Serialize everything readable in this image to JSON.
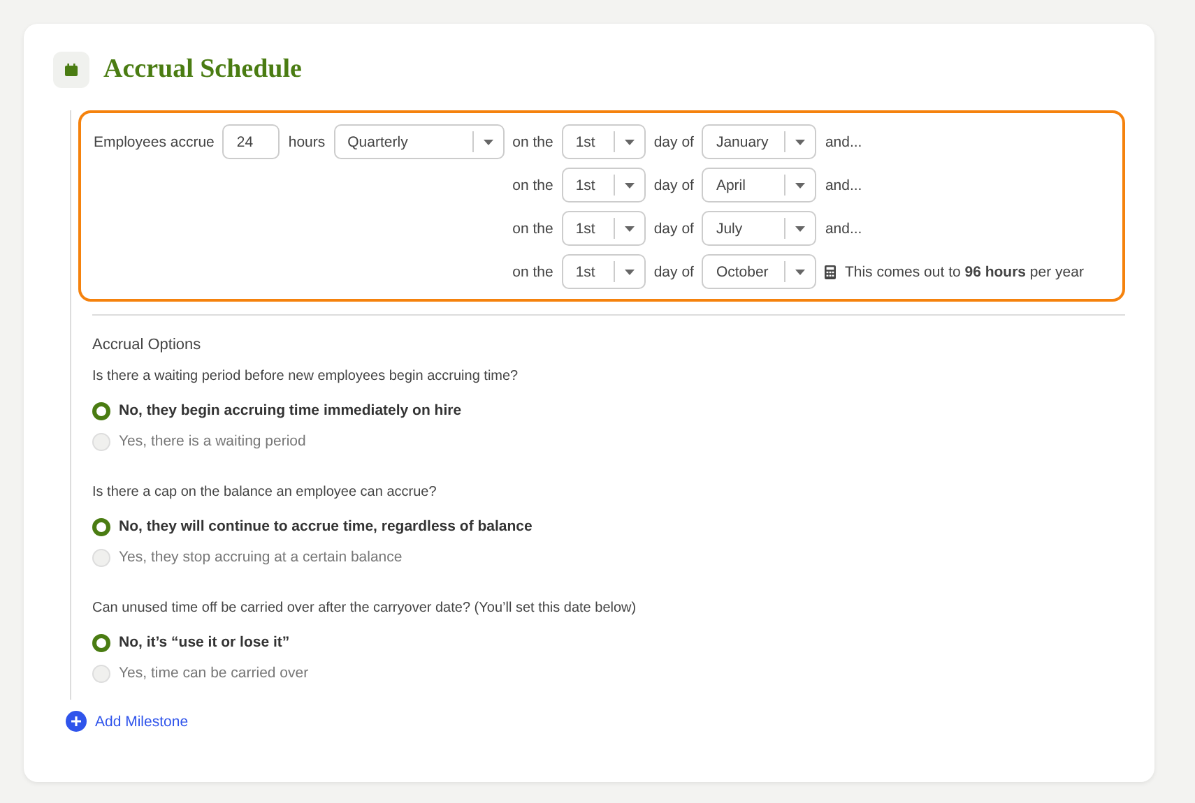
{
  "section": {
    "title": "Accrual Schedule"
  },
  "schedule": {
    "lead": "Employees accrue",
    "hours": "24",
    "hours_label": "hours",
    "frequency": "Quarterly",
    "rows": [
      {
        "prefix": "on the",
        "day": "1st",
        "middle": "day of",
        "month": "January",
        "kind": "continue",
        "suffix": "and..."
      },
      {
        "prefix": "on the",
        "day": "1st",
        "middle": "day of",
        "month": "April",
        "kind": "continue",
        "suffix": "and..."
      },
      {
        "prefix": "on the",
        "day": "1st",
        "middle": "day of",
        "month": "July",
        "kind": "continue",
        "suffix": "and..."
      },
      {
        "prefix": "on the",
        "day": "1st",
        "middle": "day of",
        "month": "October",
        "kind": "summary",
        "suffix": "This comes out to **96 hours** per year"
      }
    ]
  },
  "options": {
    "title": "Accrual Options",
    "questions": [
      {
        "question": "Is there a waiting period before new employees begin accruing time?",
        "choices": [
          {
            "label": "No, they begin accruing time immediately on hire",
            "selected": true
          },
          {
            "label": "Yes, there is a waiting period",
            "selected": false
          }
        ]
      },
      {
        "question": "Is there a cap on the balance an employee can accrue?",
        "choices": [
          {
            "label": "No, they will continue to accrue time, regardless of balance",
            "selected": true
          },
          {
            "label": "Yes, they stop accruing at a certain balance",
            "selected": false
          }
        ]
      },
      {
        "question": "Can unused time off be carried over after the carryover date? (You’ll set this date below)",
        "choices": [
          {
            "label": "No, it’s “use it or lose it”",
            "selected": true
          },
          {
            "label": "Yes, time can be carried over",
            "selected": false
          }
        ]
      }
    ]
  },
  "add_button": "Add Milestone"
}
